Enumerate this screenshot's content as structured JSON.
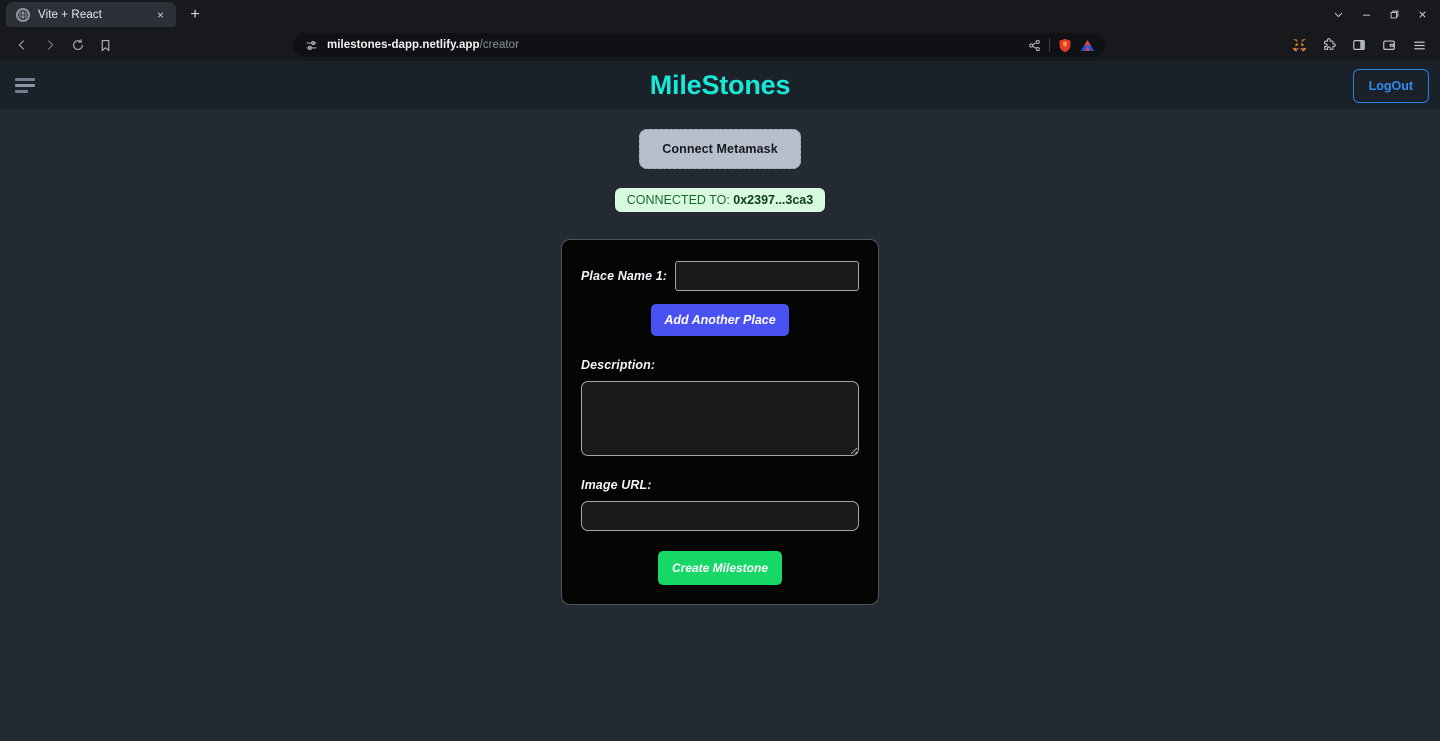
{
  "browser": {
    "tab": {
      "title": "Vite + React",
      "favicon": "globe-icon",
      "close_label": "×"
    },
    "newtab_label": "+",
    "window_controls": {
      "tab_search": "tab-search-icon",
      "minimize": "minimize-icon",
      "maximize": "maximize-icon",
      "close": "close-icon"
    },
    "nav": {
      "back": "back-arrow-icon",
      "forward": "forward-arrow-icon",
      "reload": "reload-icon",
      "bookmark": "bookmark-icon"
    },
    "omnibox": {
      "site_icon": "site-settings-icon",
      "domain": "milestones-dapp.netlify.app",
      "path": "/creator",
      "share_icon": "share-icon",
      "shield_icon": "brave-shields-icon",
      "wallet_icon": "wallet-triangle-icon"
    },
    "extensions": [
      {
        "name": "metamask-extension-icon",
        "label": "MetaMask"
      },
      {
        "name": "extensions-puzzle-icon",
        "label": "Extensions"
      },
      {
        "name": "sidebar-panel-icon",
        "label": "Sidebar"
      },
      {
        "name": "wallet-icon",
        "label": "Wallet"
      },
      {
        "name": "browser-menu-icon",
        "label": "Menu"
      }
    ]
  },
  "app": {
    "header": {
      "menu_icon": "hamburger-menu-icon",
      "brand": "MileStones",
      "logout_label": "LogOut"
    },
    "connect_button_label": "Connect Metamask",
    "status": {
      "prefix": "CONNECTED TO: ",
      "address": "0x2397...3ca3"
    },
    "form": {
      "place_name_label": "Place Name 1:",
      "place_name_value": "",
      "place_name_placeholder": "",
      "add_another_label": "Add Another Place",
      "description_label": "Description:",
      "description_value": "",
      "description_placeholder": "",
      "image_url_label": "Image URL:",
      "image_url_value": "",
      "image_url_placeholder": "",
      "submit_label": "Create Milestone"
    }
  },
  "colors": {
    "brand": "#18e8d8",
    "accent_blue": "#4a51f2",
    "success_green": "#17d866",
    "status_bg": "#d9fadf",
    "status_text": "#186a2c",
    "page_bg": "#242a33",
    "header_bg": "#1b2129",
    "card_bg": "#050505"
  }
}
